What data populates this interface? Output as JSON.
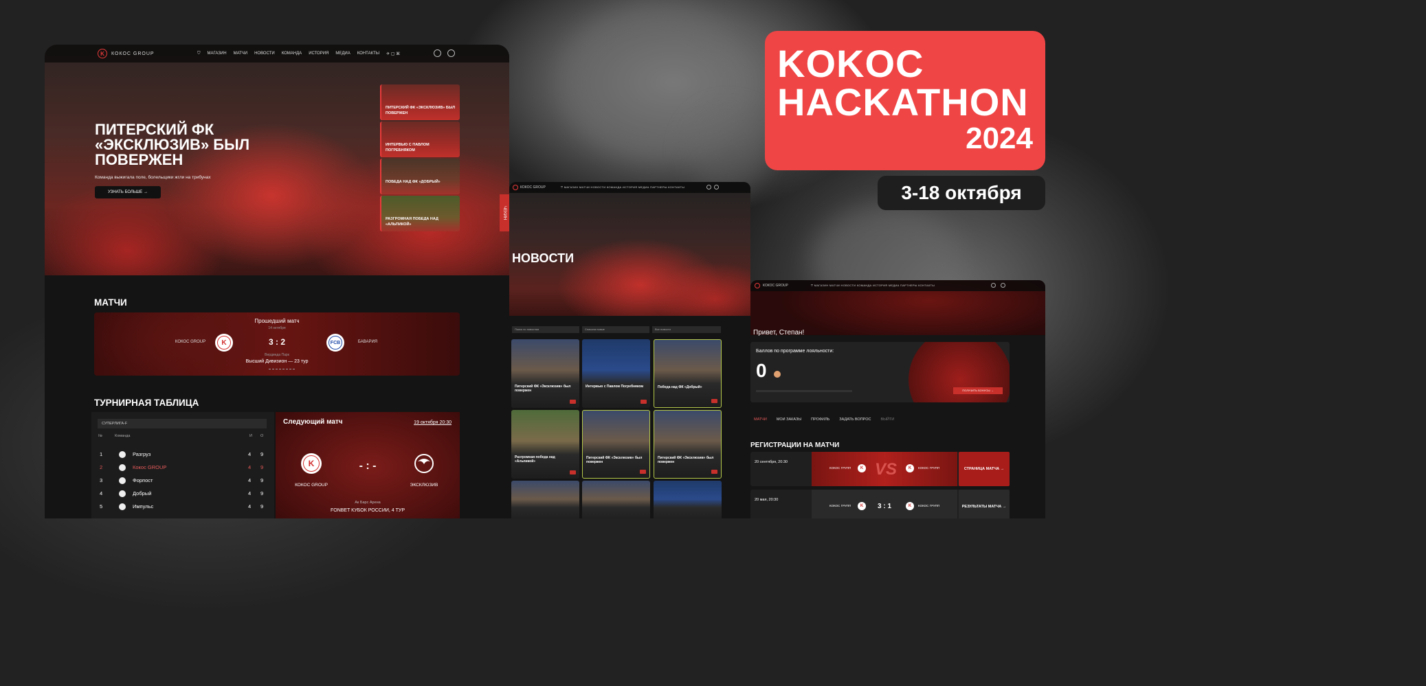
{
  "poster": {
    "line1": "KOKOC",
    "line2": "HACKATHON",
    "year": "2024",
    "dates": "3-18 октября"
  },
  "site1": {
    "brand": "КОКОС GROUP",
    "nav": [
      "МАГАЗИН",
      "МАТЧИ",
      "НОВОСТИ",
      "КОМАНДА",
      "ИСТОРИЯ",
      "МЕДИА",
      "КОНТАКТЫ"
    ],
    "hero": {
      "title": "ПИТЕРСКИЙ ФК «ЭКСКЛЮЗИВ» БЫЛ ПОВЕРЖЕН",
      "subtitle": "Команда выжигала поле, болельщики жгли на трибунах",
      "button": "УЗНАТЬ БОЛЬШЕ →"
    },
    "side_news": [
      "ПИТЕРСКИЙ ФК «ЭКСКЛЮЗИВ» БЫЛ ПОВЕРЖЕН",
      "ИНТЕРВЬЮ С ПАВЛОМ ПОГРЕБНЯКОМ",
      "ПОБЕДА НАД ФК «ДОБРЫЙ»",
      "РАЗГРОМНАЯ ПОБЕДА НАД «АЛЬПИКОЙ»"
    ],
    "side_tab": "ЧЕКИН",
    "matches_title": "МАТЧИ",
    "last_match": {
      "label": "Прошедший матч",
      "date": "14 октября",
      "home": "КОКОС GROUP",
      "score": "3 : 2",
      "away": "БАВАРИЯ",
      "venue": "Вердинда Парк",
      "league": "Высший Дивизион — 23 тур"
    },
    "table_title": "ТУРНИРНАЯ ТАБЛИЦА",
    "table": {
      "league": "СУПЕРЛИГА-F",
      "headers": [
        "№",
        "Команда",
        "И",
        "О"
      ],
      "rows": [
        {
          "pos": "1",
          "team": "Разгруз",
          "played": "4",
          "points": "9"
        },
        {
          "pos": "2",
          "team": "Кокос GROUP",
          "played": "4",
          "points": "9"
        },
        {
          "pos": "3",
          "team": "Форпост",
          "played": "4",
          "points": "9"
        },
        {
          "pos": "4",
          "team": "Добрый",
          "played": "4",
          "points": "9"
        },
        {
          "pos": "5",
          "team": "Импульс",
          "played": "4",
          "points": "9"
        }
      ]
    },
    "next_match": {
      "label": "Следующий матч",
      "date": "19 октября 20:30",
      "home": "КОКОС GROUP",
      "score": "- : -",
      "away": "ЭКСКЛЮЗИВ",
      "venue": "Ак Барс Арена",
      "league": "FONBET КУБОК РОССИИ, 4 ТУР"
    }
  },
  "site2": {
    "brand": "КОКОС GROUP",
    "title": "НОВОСТИ",
    "filters": [
      "Поиск по новостям",
      "Сначала новые",
      "Все новости"
    ],
    "cards": [
      "Питерский ФК «Эксклюзив» был повержен",
      "Интервью с Павлом Погребняком",
      "Победа над ФК «Добрый»",
      "Разгромная победа над «Альпикой»",
      "Питерский ФК «Эксклюзив» был повержен",
      "Питерский ФК «Эксклюзив» был повержен"
    ]
  },
  "site3": {
    "brand": "КОКОС GROUP",
    "greeting": "Привет, Степан!",
    "loyalty_label": "Баллов по программе лояльности:",
    "loyalty_value": "0",
    "bonus_button": "ПОЛУЧИТЬ БОНУСЫ →",
    "tabs": [
      "МАТЧИ",
      "МОИ ЗАКАЗЫ",
      "ПРОФИЛЬ",
      "ЗАДАТЬ ВОПРОС",
      "ВЫЙТИ"
    ],
    "section": "РЕГИСТРАЦИИ НА МАТЧИ",
    "registrations": [
      {
        "date": "20 сентября, 20:30",
        "home": "КОКОС ГРУПП",
        "center": "VS",
        "away": "КОКОС ГРУПП",
        "button": "СТРАНИЦА МАТЧА →"
      },
      {
        "date": "20 мая, 20:30",
        "home": "КОКОС ГРУПП",
        "center": "3 : 1",
        "away": "КОКОС ГРУПП",
        "button": "РЕЗУЛЬТАТЫ МАТЧА →"
      }
    ]
  },
  "colors": {
    "accent": "#f04545",
    "dark": "#141414",
    "red": "#c8302b"
  }
}
